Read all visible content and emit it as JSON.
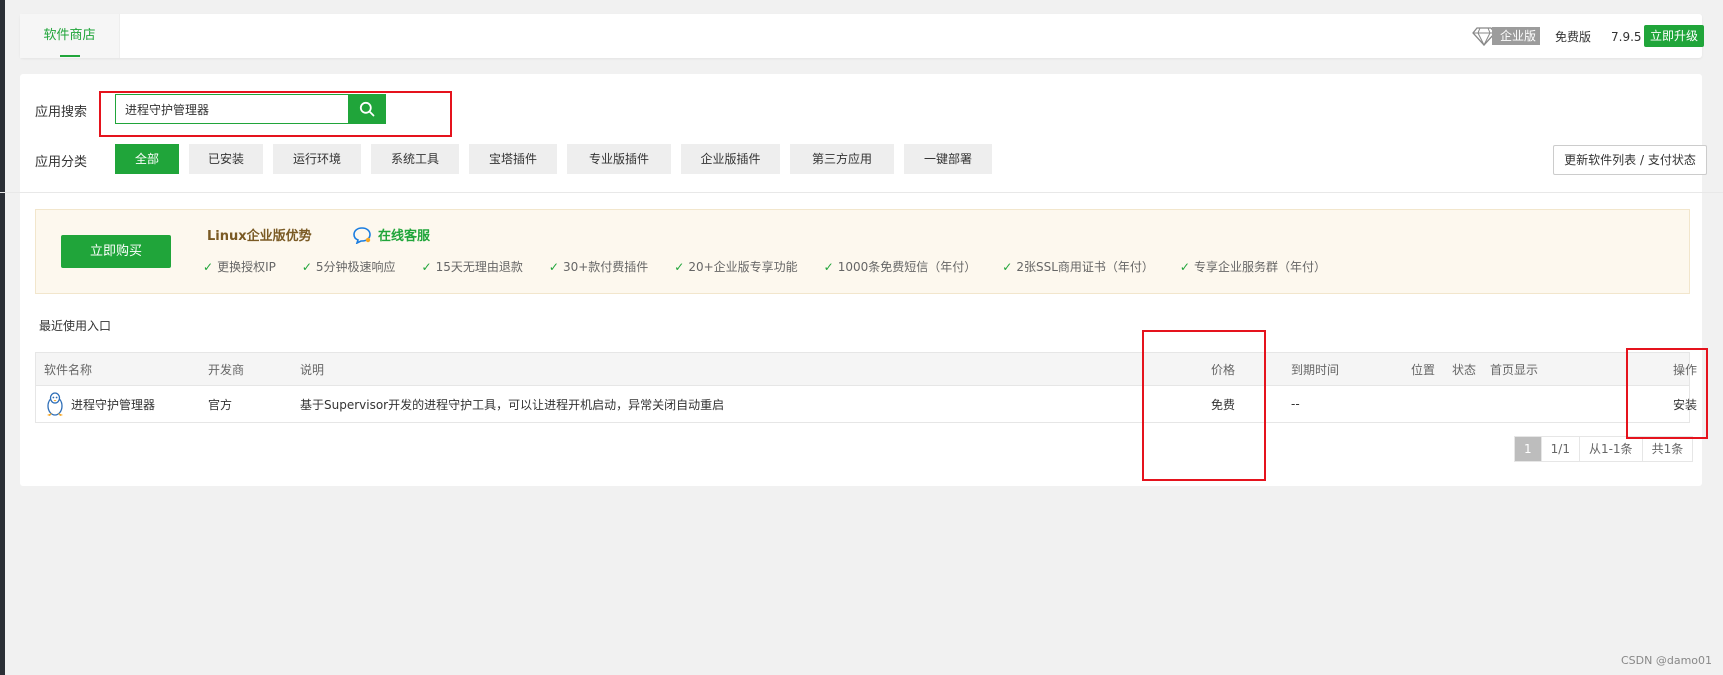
{
  "header": {
    "tab_store": "软件商店",
    "enterprise_badge": "企业版",
    "free_version": "免费版",
    "version": "7.9.5",
    "upgrade_button": "立即升级"
  },
  "search": {
    "label": "应用搜索",
    "value": "进程守护管理器"
  },
  "category": {
    "label": "应用分类",
    "items": [
      "全部",
      "已安装",
      "运行环境",
      "系统工具",
      "宝塔插件",
      "专业版插件",
      "企业版插件",
      "第三方应用",
      "一键部署"
    ],
    "active_index": 0
  },
  "refresh_button": "更新软件列表 / 支付状态",
  "promo": {
    "buy_button": "立即购买",
    "title": "Linux企业版优势",
    "online_service": "在线客服",
    "features": [
      "更换授权IP",
      "5分钟极速响应",
      "15天无理由退款",
      "30+款付费插件",
      "20+企业版专享功能",
      "1000条免费短信（年付）",
      "2张SSL商用证书（年付）",
      "专享企业服务群（年付）"
    ]
  },
  "recent_entry": "最近使用入口",
  "table": {
    "headers": {
      "name": "软件名称",
      "developer": "开发商",
      "description": "说明",
      "price": "价格",
      "expire": "到期时间",
      "position": "位置",
      "status": "状态",
      "homepage": "首页显示",
      "action": "操作"
    },
    "rows": [
      {
        "name": "进程守护管理器",
        "developer": "官方",
        "description": "基于Supervisor开发的进程守护工具，可以让进程开机启动，异常关闭自动重启",
        "price": "免费",
        "expire": "--",
        "action": "安装"
      }
    ]
  },
  "pagination": {
    "current": "1",
    "pages": "1/1",
    "range": "从1-1条",
    "total": "共1条"
  },
  "watermark": "CSDN @damo01",
  "colors": {
    "accent": "#20a53a",
    "highlight_box": "#e5131d"
  }
}
